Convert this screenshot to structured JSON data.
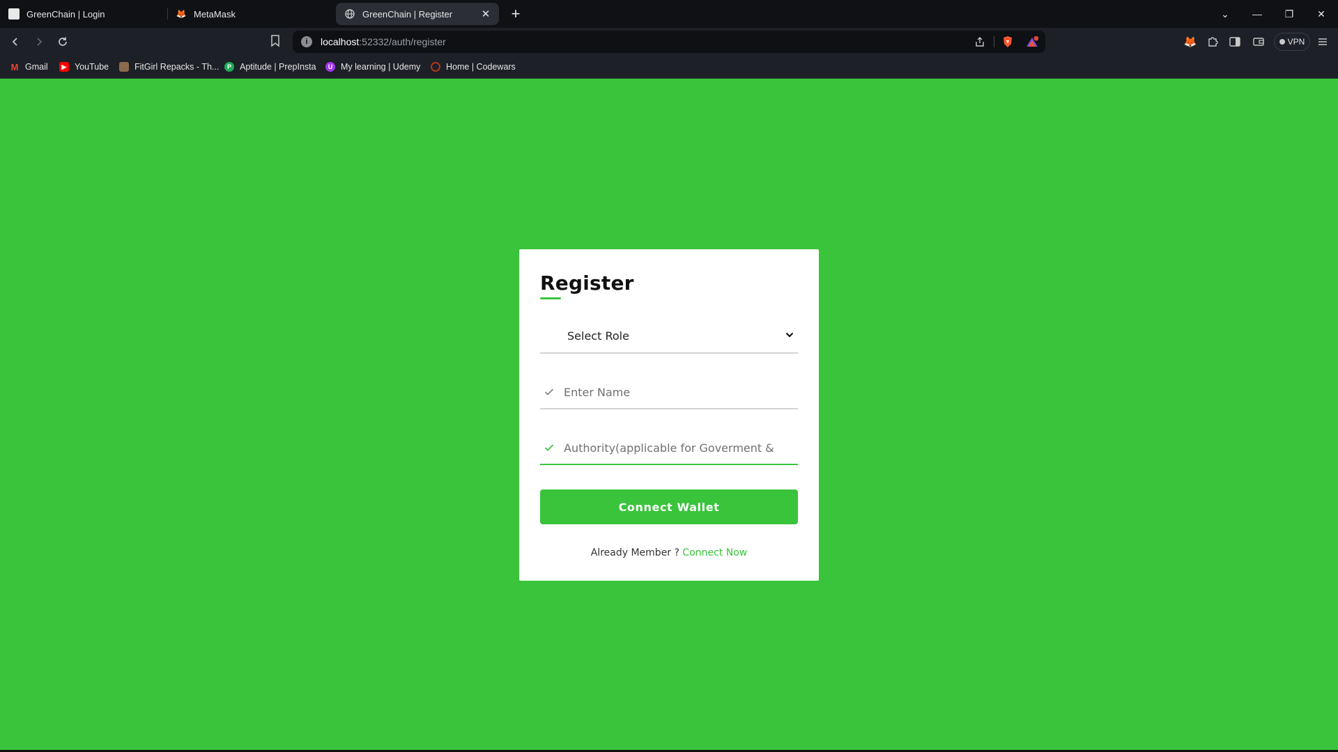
{
  "browser": {
    "tabs": [
      {
        "title": "GreenChain | Login",
        "icon": "page-icon"
      },
      {
        "title": "MetaMask",
        "icon": "metamask-fox-icon"
      },
      {
        "title": "GreenChain | Register",
        "icon": "globe-icon",
        "active": true
      }
    ],
    "url": {
      "host": "localhost",
      "rest": ":52332/auth/register"
    },
    "vpn_label": "VPN",
    "bookmarks": [
      {
        "label": "Gmail",
        "icon": "gmail-icon",
        "color": "#ea4335"
      },
      {
        "label": "YouTube",
        "icon": "youtube-icon",
        "color": "#ff0000"
      },
      {
        "label": "FitGirl Repacks - Th...",
        "icon": "fitgirl-icon",
        "color": "#8a6a4a"
      },
      {
        "label": "Aptitude | PrepInsta",
        "icon": "prepinsta-icon",
        "color": "#1faa59"
      },
      {
        "label": "My learning | Udemy",
        "icon": "udemy-icon",
        "color": "#a435f0"
      },
      {
        "label": "Home | Codewars",
        "icon": "codewars-icon",
        "color": "#b1361e"
      }
    ]
  },
  "register": {
    "title": "Register",
    "role_select": {
      "value": "Select Role"
    },
    "name_field": {
      "placeholder": "Enter Name"
    },
    "authority_field": {
      "placeholder": "Authority(applicable for Goverment & "
    },
    "connect_button": "Connect Wallet",
    "footer": {
      "text": "Already Member ? ",
      "link": "Connect Now"
    }
  },
  "colors": {
    "accent": "#39c43b",
    "background": "#39c43b",
    "card": "#ffffff"
  }
}
